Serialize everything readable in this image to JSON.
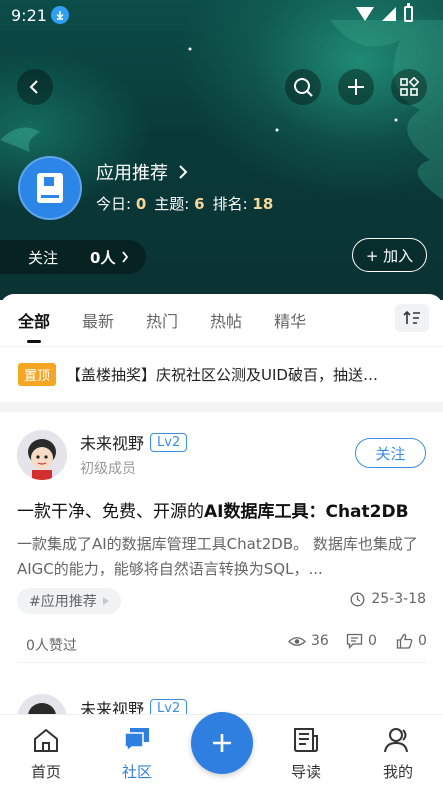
{
  "status_bar": {
    "time": "9:21"
  },
  "forum": {
    "name": "应用推荐",
    "stats": {
      "today_label": "今日:",
      "today": "0",
      "topics_label": "主题:",
      "topics": "6",
      "rank_label": "排名:",
      "rank": "18"
    },
    "follow_label": "关注",
    "follow_count": "0人",
    "join_label": "+ 加入"
  },
  "tabs": [
    "全部",
    "最新",
    "热门",
    "热帖",
    "精华"
  ],
  "pinned": {
    "badge": "置顶",
    "text": "【盖楼抽奖】庆祝社区公测及UID破百，抽送…"
  },
  "post": {
    "author": "未来视野",
    "level": "Lv2",
    "role": "初级成员",
    "follow_label": "关注",
    "title_prefix": "一款干净、免费、开源的",
    "title_bold": "AI数据库工具：Chat2DB",
    "excerpt": "一款集成了AI的数据库管理工具Chat2DB。 数据库也集成了AIGC的能力，能够将自然语言转换为SQL，...",
    "tag": "#应用推荐",
    "date": "25-3-18",
    "likes": "0人赞过",
    "views": "36",
    "comments": "0",
    "thumbs": "0"
  },
  "post2": {
    "author": "未来视野",
    "level": "Lv2"
  },
  "bottom_nav": {
    "home": "首页",
    "community": "社区",
    "guide": "导读",
    "mine": "我的"
  }
}
